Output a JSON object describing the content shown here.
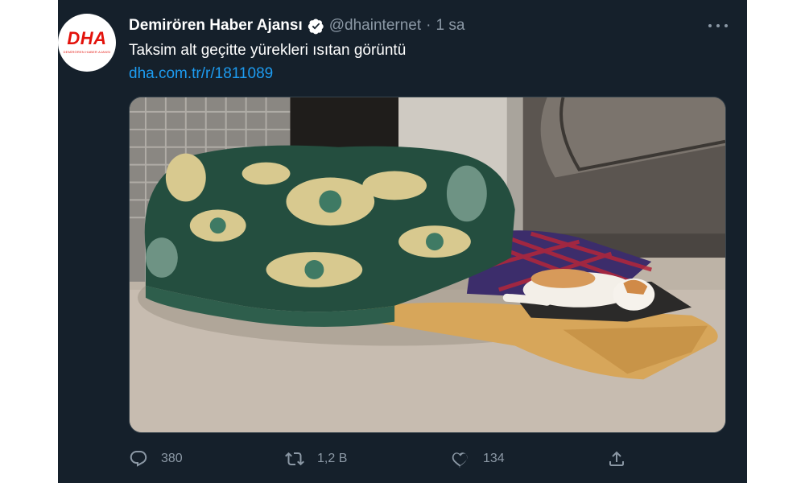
{
  "tweet": {
    "avatar": {
      "logo_text": "DHA",
      "logo_subtext": "DEMİRÖREN HABER AJANSI",
      "brand_color": "#e3120b"
    },
    "display_name": "Demirören Haber Ajansı",
    "verified_icon": "verified-badge-icon",
    "handle": "@dhainternet",
    "separator": "·",
    "time": "1 sa",
    "more_icon": "more-options-icon",
    "text": "Taksim alt geçitte yürekleri ısıtan görüntü",
    "link": "dha.com.tr/r/1811089",
    "link_color": "#1d9bf0",
    "media_alt": "Cat sleeping under blankets in an underpass",
    "actions": {
      "reply": {
        "icon": "reply-icon",
        "count": "380"
      },
      "retweet": {
        "icon": "retweet-icon",
        "count": "1,2 B"
      },
      "like": {
        "icon": "heart-icon",
        "count": "134"
      },
      "share": {
        "icon": "share-icon"
      }
    }
  },
  "colors": {
    "background": "#15202b",
    "text_primary": "#ffffff",
    "text_secondary": "#8b98a5"
  }
}
